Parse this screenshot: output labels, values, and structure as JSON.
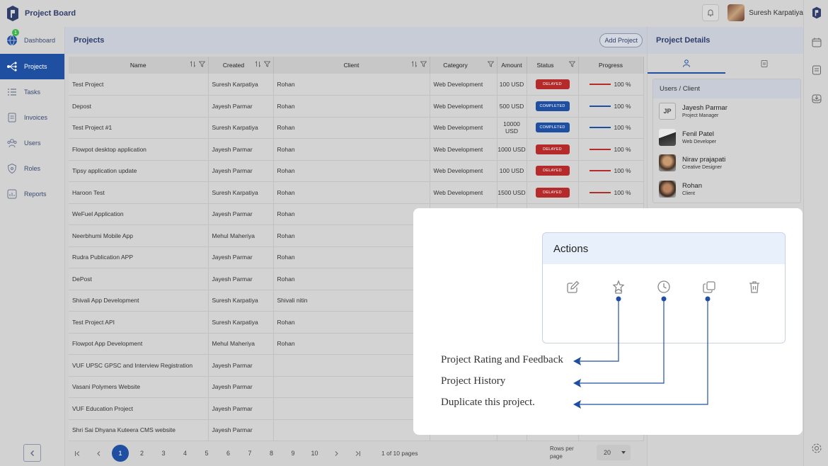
{
  "app": {
    "title": "Project Board"
  },
  "user": {
    "name": "Suresh Karpatiya"
  },
  "nav": [
    {
      "label": "Dashboard",
      "icon": "globe-icon",
      "badge": "1"
    },
    {
      "label": "Projects",
      "icon": "projects-icon",
      "active": true
    },
    {
      "label": "Tasks",
      "icon": "tasks-icon"
    },
    {
      "label": "Invoices",
      "icon": "invoice-icon"
    },
    {
      "label": "Users",
      "icon": "users-icon"
    },
    {
      "label": "Roles",
      "icon": "shield-icon"
    },
    {
      "label": "Reports",
      "icon": "reports-icon"
    }
  ],
  "projects": {
    "title": "Projects",
    "add_label": "Add Project",
    "columns": [
      "Name",
      "Created",
      "Client",
      "Category",
      "Amount",
      "Status",
      "Progress"
    ],
    "rows": [
      {
        "name": "Test Project",
        "created": "Suresh Karpatiya",
        "client": "Rohan",
        "category": "Web Development",
        "amount": "100 USD",
        "status": "DELAYED",
        "progress": "100 %"
      },
      {
        "name": "Depost",
        "created": "Jayesh Parmar",
        "client": "Rohan",
        "category": "Web Development",
        "amount": "500 USD",
        "status": "COMPLETED",
        "progress": "100 %"
      },
      {
        "name": "Test Project #1",
        "created": "Suresh Karpatiya",
        "client": "Rohan",
        "category": "Web Development",
        "amount": "10000 USD",
        "status": "COMPLETED",
        "progress": "100 %"
      },
      {
        "name": "Flowpot desktop application",
        "created": "Jayesh Parmar",
        "client": "Rohan",
        "category": "Web Development",
        "amount": "1000 USD",
        "status": "DELAYED",
        "progress": "100 %"
      },
      {
        "name": "Tipsy application update",
        "created": "Jayesh Parmar",
        "client": "Rohan",
        "category": "Web Development",
        "amount": "100 USD",
        "status": "DELAYED",
        "progress": "100 %"
      },
      {
        "name": "Haroon Test",
        "created": "Suresh Karpatiya",
        "client": "Rohan",
        "category": "Web Development",
        "amount": "1500 USD",
        "status": "DELAYED",
        "progress": "100 %"
      },
      {
        "name": "WeFuel Application",
        "created": "Jayesh Parmar",
        "client": "Rohan",
        "category": "",
        "amount": "",
        "status": "",
        "progress": ""
      },
      {
        "name": "Neerbhumi Mobile App",
        "created": "Mehul Maheriya",
        "client": "Rohan",
        "category": "",
        "amount": "",
        "status": "",
        "progress": ""
      },
      {
        "name": "Rudra Publication APP",
        "created": "Jayesh Parmar",
        "client": "Rohan",
        "category": "",
        "amount": "",
        "status": "",
        "progress": ""
      },
      {
        "name": "DePost",
        "created": "Jayesh Parmar",
        "client": "Rohan",
        "category": "",
        "amount": "",
        "status": "",
        "progress": ""
      },
      {
        "name": "Shivali App Development",
        "created": "Suresh Karpatiya",
        "client": "Shivali nitin",
        "category": "",
        "amount": "",
        "status": "",
        "progress": ""
      },
      {
        "name": "Test Project API",
        "created": "Suresh Karpatiya",
        "client": "Rohan",
        "category": "",
        "amount": "",
        "status": "",
        "progress": ""
      },
      {
        "name": "Flowpot App Development",
        "created": "Mehul Maheriya",
        "client": "Rohan",
        "category": "",
        "amount": "",
        "status": "",
        "progress": ""
      },
      {
        "name": "VUF UPSC GPSC and Interview  Registration",
        "created": "Jayesh Parmar",
        "client": "",
        "category": "",
        "amount": "",
        "status": "",
        "progress": ""
      },
      {
        "name": "Vasani Polymers Website",
        "created": "Jayesh Parmar",
        "client": "",
        "category": "",
        "amount": "",
        "status": "",
        "progress": ""
      },
      {
        "name": "VUF Education Project",
        "created": "Jayesh Parmar",
        "client": "",
        "category": "",
        "amount": "",
        "status": "",
        "progress": ""
      },
      {
        "name": "Shri Sai Dhyana Kuteera CMS website",
        "created": "Jayesh Parmar",
        "client": "",
        "category": "",
        "amount": "",
        "status": "",
        "progress": ""
      }
    ]
  },
  "pagination": {
    "pages": [
      "1",
      "2",
      "3",
      "4",
      "5",
      "6",
      "7",
      "8",
      "9",
      "10"
    ],
    "current": "1",
    "info": "1 of 10 pages",
    "rows_per_page_label": "Rows per page",
    "rows_per_page": "20"
  },
  "details": {
    "title": "Project Details",
    "section_title": "Users / Client",
    "people": [
      {
        "name": "Jayesh Parmar",
        "role": "Project Manager",
        "initials": "JP"
      },
      {
        "name": "Fenil Patel",
        "role": "Web Developer",
        "initials": ""
      },
      {
        "name": "Nirav prajapati",
        "role": "Creative Designer",
        "initials": ""
      },
      {
        "name": "Rohan",
        "role": "Client",
        "initials": ""
      }
    ]
  },
  "overlay": {
    "actions_title": "Actions",
    "callouts": [
      "Project Rating and Feedback",
      "Project History",
      "Duplicate this project."
    ]
  },
  "colors": {
    "primary": "#1e4fa0",
    "delayed": "#b52a2a",
    "completed": "#1e4fa0"
  }
}
